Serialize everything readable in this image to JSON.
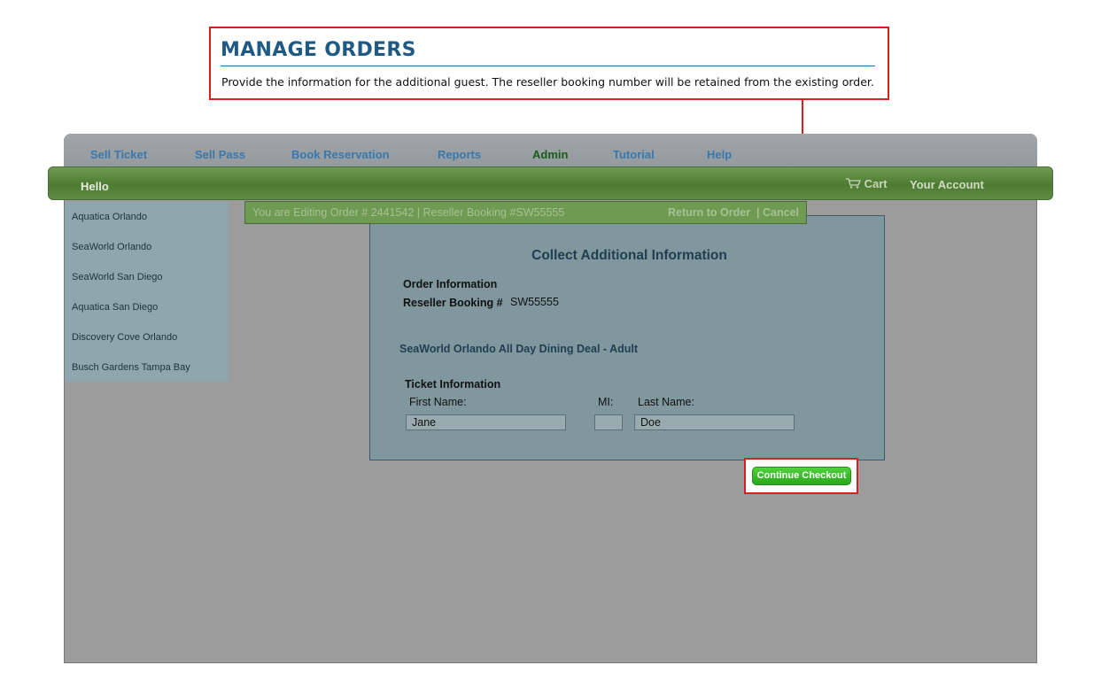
{
  "callout": {
    "title": "MANAGE ORDERS",
    "description": "Provide the information for the additional guest. The reseller booking number will be retained from the existing order."
  },
  "nav": {
    "items": [
      {
        "label": "Sell Ticket"
      },
      {
        "label": "Sell Pass"
      },
      {
        "label": "Book Reservation"
      },
      {
        "label": "Reports"
      },
      {
        "label": "Admin"
      },
      {
        "label": "Tutorial"
      },
      {
        "label": "Help"
      }
    ]
  },
  "greenbar": {
    "hello": "Hello",
    "cart": "Cart",
    "account": "Your Account"
  },
  "sidebar": {
    "items": [
      {
        "label": "Aquatica Orlando"
      },
      {
        "label": "SeaWorld Orlando"
      },
      {
        "label": "SeaWorld San Diego"
      },
      {
        "label": "Aquatica San Diego"
      },
      {
        "label": "Discovery Cove Orlando"
      },
      {
        "label": "Busch Gardens Tampa Bay"
      }
    ]
  },
  "editbar": {
    "info": "You are Editing Order # 2441542  | Reseller Booking #SW55555",
    "return_label": "Return to Order",
    "cancel_label": "Cancel"
  },
  "panel": {
    "heading": "Collect Additional Information",
    "order_info_label": "Order Information",
    "booking_label": "Reseller Booking #",
    "booking_value": "SW55555",
    "product": "SeaWorld Orlando All Day Dining Deal - Adult",
    "ticket_info_label": "Ticket Information",
    "first_name_label": "First Name:",
    "mi_label": "MI:",
    "last_name_label": "Last Name:",
    "first_name_value": "Jane",
    "mi_value": "",
    "last_name_value": "Doe"
  },
  "button": {
    "continue_label": "Continue Checkout"
  },
  "colors": {
    "callout_border": "#d81e1e",
    "title": "#1f5a85",
    "greenbar": "#5f8b44",
    "button": "#2aa71c"
  }
}
